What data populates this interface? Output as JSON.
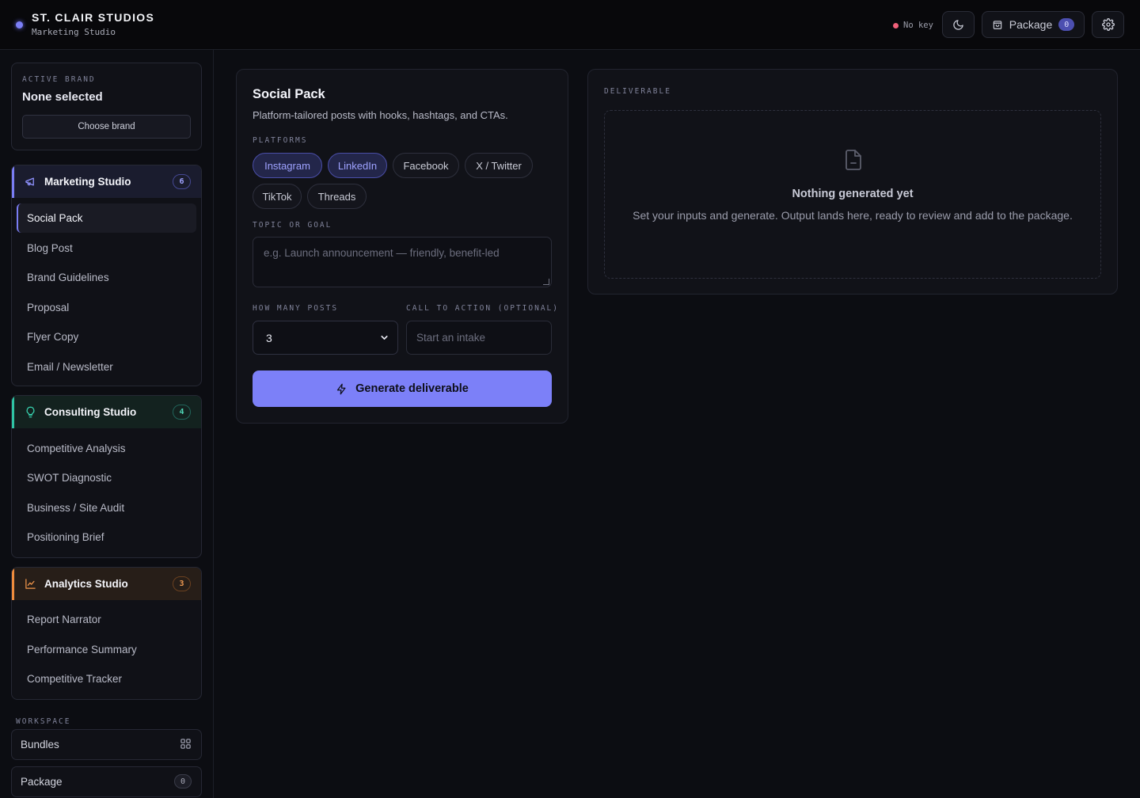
{
  "header": {
    "brand_name": "ST. CLAIR STUDIOS",
    "brand_sub": "Marketing Studio",
    "key_status": "No key",
    "package_label": "Package",
    "package_count": "0",
    "icons": [
      "moon-icon",
      "bag-icon",
      "gear-icon"
    ]
  },
  "sidebar": {
    "active_brand_caption": "ACTIVE BRAND",
    "active_brand_value": "None selected",
    "choose_brand_label": "Choose brand",
    "studios": [
      {
        "name": "Marketing Studio",
        "count": "6",
        "accent": "#7a7df4",
        "icon": "megaphone-icon",
        "items": [
          "Social Pack",
          "Blog Post",
          "Brand Guidelines",
          "Proposal",
          "Flyer Copy",
          "Email / Newsletter"
        ],
        "active_item": "Social Pack"
      },
      {
        "name": "Consulting Studio",
        "count": "4",
        "accent": "#2fc4a4",
        "icon": "lightbulb-icon",
        "items": [
          "Competitive Analysis",
          "SWOT Diagnostic",
          "Business / Site Audit",
          "Positioning Brief"
        ]
      },
      {
        "name": "Analytics Studio",
        "count": "3",
        "accent": "#ef8c3d",
        "icon": "chart-line-icon",
        "items": [
          "Report Narrator",
          "Performance Summary",
          "Competitive Tracker"
        ]
      }
    ],
    "workspace_caption": "WORKSPACE",
    "workspace_items": [
      {
        "label": "Bundles",
        "icon": "grid-icon"
      },
      {
        "label": "Package",
        "count": "0"
      }
    ]
  },
  "form": {
    "title": "Social Pack",
    "description": "Platform-tailored posts with hooks, hashtags, and CTAs.",
    "platforms_caption": "PLATFORMS",
    "platforms": [
      {
        "label": "Instagram",
        "selected": true
      },
      {
        "label": "LinkedIn",
        "selected": true
      },
      {
        "label": "Facebook",
        "selected": false
      },
      {
        "label": "X / Twitter",
        "selected": false
      },
      {
        "label": "TikTok",
        "selected": false
      },
      {
        "label": "Threads",
        "selected": false
      }
    ],
    "topic_caption": "TOPIC OR GOAL",
    "topic_placeholder": "e.g. Launch announcement — friendly, benefit-led",
    "posts_caption": "HOW MANY POSTS",
    "posts_value": "3",
    "cta_caption": "CALL TO ACTION (OPTIONAL)",
    "cta_placeholder": "Start an intake",
    "generate_label": "Generate deliverable",
    "accent": "#7c80f8"
  },
  "deliverable": {
    "caption": "DELIVERABLE",
    "empty_title": "Nothing generated yet",
    "empty_text": "Set your inputs and generate. Output lands here, ready to review and add to the package."
  }
}
